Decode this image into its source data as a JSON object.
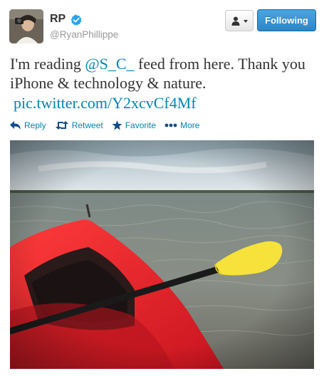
{
  "user": {
    "name": "RP",
    "handle": "@RyanPhillippe"
  },
  "buttons": {
    "follow_label": "Following"
  },
  "tweet": {
    "text_before": "I'm reading ",
    "mention": "@S_C_",
    "text_after": " feed from here. Thank you iPhone & technology & nature.",
    "pic_link": "pic.twitter.com/Y2xcvCf4Mf"
  },
  "actions": [
    {
      "label": "Reply",
      "icon": "reply-icon"
    },
    {
      "label": "Retweet",
      "icon": "retweet-icon"
    },
    {
      "label": "Favorite",
      "icon": "star-icon"
    },
    {
      "label": "More",
      "icon": "more-dots-icon"
    }
  ],
  "colors": {
    "link": "#0084b4",
    "follow_button": "#2c86c7",
    "verified": "#2aa3ef",
    "kayak": "#e8262f",
    "paddle_blade": "#f6e23a"
  }
}
